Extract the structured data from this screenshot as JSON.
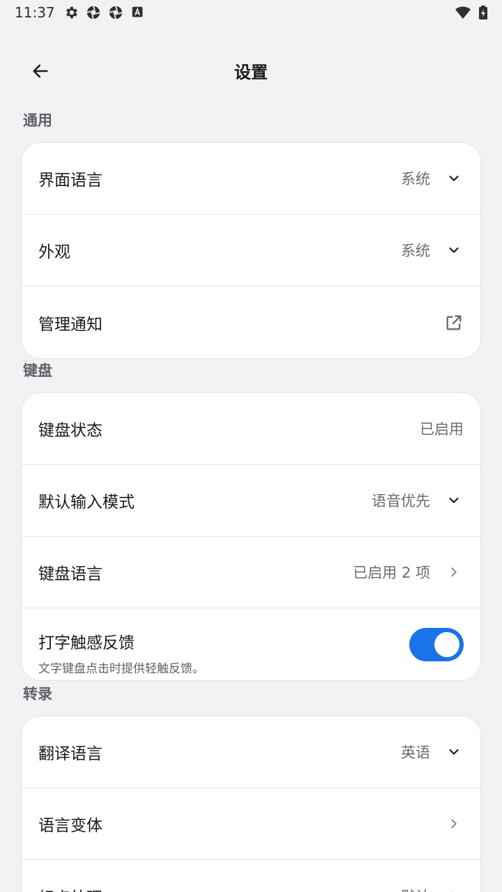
{
  "status_bar": {
    "time": "11:37",
    "icons_left": [
      "gear-icon",
      "shutter-icon",
      "shutter-icon",
      "keyboard-a-icon"
    ],
    "icons_right": [
      "wifi-icon",
      "battery-charging-icon"
    ]
  },
  "header": {
    "title": "设置",
    "back_icon": "arrow-back-icon"
  },
  "sections": {
    "general": {
      "title": "通用",
      "items": [
        {
          "label": "界面语言",
          "value": "系统",
          "icon": "chevron-down-icon"
        },
        {
          "label": "外观",
          "value": "系统",
          "icon": "chevron-down-icon"
        },
        {
          "label": "管理通知",
          "value": "",
          "icon": "open-external-icon"
        }
      ]
    },
    "keyboard": {
      "title": "键盘",
      "items": [
        {
          "label": "键盘状态",
          "value": "已启用"
        },
        {
          "label": "默认输入模式",
          "value": "语音优先",
          "icon": "chevron-down-icon"
        },
        {
          "label": "键盘语言",
          "value": "已启用 2 项",
          "icon": "chevron-right-icon"
        },
        {
          "label": "打字触感反馈",
          "sublabel": "文字键盘点击时提供轻触反馈。",
          "toggle_on": true
        }
      ]
    },
    "transcription": {
      "title": "转录",
      "items": [
        {
          "label": "翻译语言",
          "value": "英语",
          "icon": "chevron-down-icon"
        },
        {
          "label": "语言变体",
          "value": "",
          "icon": "chevron-right-icon"
        },
        {
          "label": "标点处理",
          "value": "默认",
          "icon": "chevron-right-icon"
        }
      ]
    }
  },
  "colors": {
    "background": "#f2f2f5",
    "card": "#ffffff",
    "accent": "#1a73e8",
    "secondary_text": "#6a6a72"
  }
}
